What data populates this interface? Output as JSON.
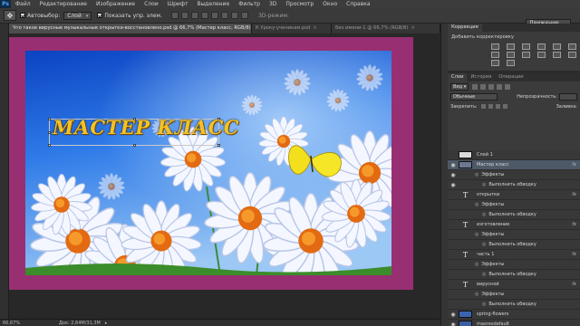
{
  "menu": [
    "Файл",
    "Редактирование",
    "Изображение",
    "Слои",
    "Шрифт",
    "Выделение",
    "Фильтр",
    "3D",
    "Просмотр",
    "Окно",
    "Справка"
  ],
  "app_logo": "Ps",
  "options": {
    "autoselect_label": "Автовыбор:",
    "autoselect_value": "Слой",
    "show_controls_label": "Показать упр. элем.",
    "mode3d_label": "3D-режим:",
    "workspace": "Движение"
  },
  "doc_tabs": [
    {
      "label": "Что такое вирусные музыкальные открытки-восстановлено.psd @ 66,7% (Мастер класс, RGB/8)",
      "active": true
    },
    {
      "label": "К Уроку-ученикам.psd",
      "active": false
    },
    {
      "label": "Без имени-1 @ 66,7% (RGB/8)",
      "active": false
    }
  ],
  "canvas": {
    "title_text": "МАСТЕР КЛАСС"
  },
  "status": {
    "zoom": "66,67%",
    "doc": "Док: 2,64M/31,3M",
    "arrow": "▸"
  },
  "panels": {
    "adj_tab": "Коррекция",
    "adj_subtitle": "Добавить корректировку",
    "layer_tabs": [
      "Слои",
      "История",
      "Операции"
    ],
    "filter_kind": "Вид",
    "blend_mode": "Обычные",
    "opacity_label": "Непрозрачность:",
    "opacity_value": "",
    "lock_label": "Закрепить:",
    "fill_label": "Заливка:"
  },
  "layers": [
    {
      "name": "Слой 1",
      "kind": "pixel",
      "visible": false,
      "selected": false,
      "thumb": "#dadada",
      "fx": false,
      "indent": 0
    },
    {
      "name": "Мастер класс",
      "kind": "pixel",
      "visible": true,
      "selected": true,
      "thumb": "#6b7890",
      "fx": true,
      "indent": 0
    },
    {
      "name": "Эффекты",
      "kind": "effect",
      "visible": true,
      "indent": 1
    },
    {
      "name": "Выполнить обводку",
      "kind": "effect",
      "visible": true,
      "indent": 2
    },
    {
      "name": "открытки",
      "kind": "text",
      "visible": false,
      "fx": true,
      "indent": 0
    },
    {
      "name": "Эффекты",
      "kind": "effect",
      "visible": false,
      "indent": 1
    },
    {
      "name": "Выполнить обводку",
      "kind": "effect",
      "visible": false,
      "indent": 2
    },
    {
      "name": "изготовление",
      "kind": "text",
      "visible": false,
      "fx": true,
      "indent": 0
    },
    {
      "name": "Эффекты",
      "kind": "effect",
      "visible": false,
      "indent": 1
    },
    {
      "name": "Выполнить обводку",
      "kind": "effect",
      "visible": false,
      "indent": 2
    },
    {
      "name": "часть 1",
      "kind": "text",
      "visible": false,
      "fx": true,
      "indent": 0
    },
    {
      "name": "Эффекты",
      "kind": "effect",
      "visible": false,
      "indent": 1
    },
    {
      "name": "Выполнить обводку",
      "kind": "effect",
      "visible": false,
      "indent": 2
    },
    {
      "name": "вирусной",
      "kind": "text",
      "visible": false,
      "fx": true,
      "indent": 0
    },
    {
      "name": "Эффекты",
      "kind": "effect",
      "visible": false,
      "indent": 1
    },
    {
      "name": "Выполнить обводку",
      "kind": "effect",
      "visible": false,
      "indent": 2
    },
    {
      "name": "spring-flowers",
      "kind": "pixel",
      "visible": true,
      "thumb": "#3b63b0",
      "fx": false,
      "indent": 0
    },
    {
      "name": "maxresdefault",
      "kind": "pixel",
      "visible": true,
      "thumb": "#3a5fa5",
      "fx": false,
      "indent": 0
    },
    {
      "name": "",
      "kind": "pixel",
      "visible": true,
      "thumb": "#8a3c6c",
      "fx": false,
      "indent": 0
    }
  ],
  "colors": {
    "frame": "#982f72",
    "title": "#f3c226",
    "selected_layer": "#4e5968"
  }
}
